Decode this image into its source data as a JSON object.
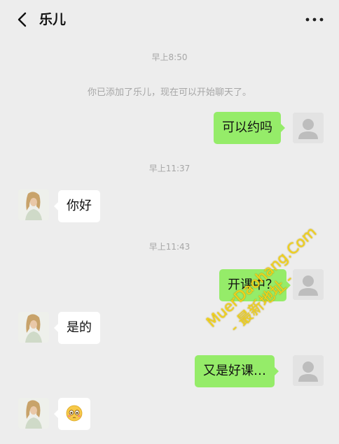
{
  "header": {
    "title": "乐儿"
  },
  "messages": {
    "time_1": "早上8:50",
    "notice": "你已添加了乐儿，现在可以开始聊天了。",
    "msg_1": "可以约吗",
    "time_2": "早上11:37",
    "msg_2": "你好",
    "time_3": "早上11:43",
    "msg_3": "开课中？",
    "msg_4": "是的",
    "msg_5": "又是好课…",
    "msg_6_icon": "flushed-face-emoji"
  },
  "watermark": {
    "line1": "MuerDaohang.Com",
    "line2": "- 最新地址 -"
  },
  "colors": {
    "background": "#ededed",
    "my_bubble": "#95ec69",
    "their_bubble": "#ffffff",
    "system_text": "#a6a6a6",
    "watermark": "#f2d21a"
  }
}
